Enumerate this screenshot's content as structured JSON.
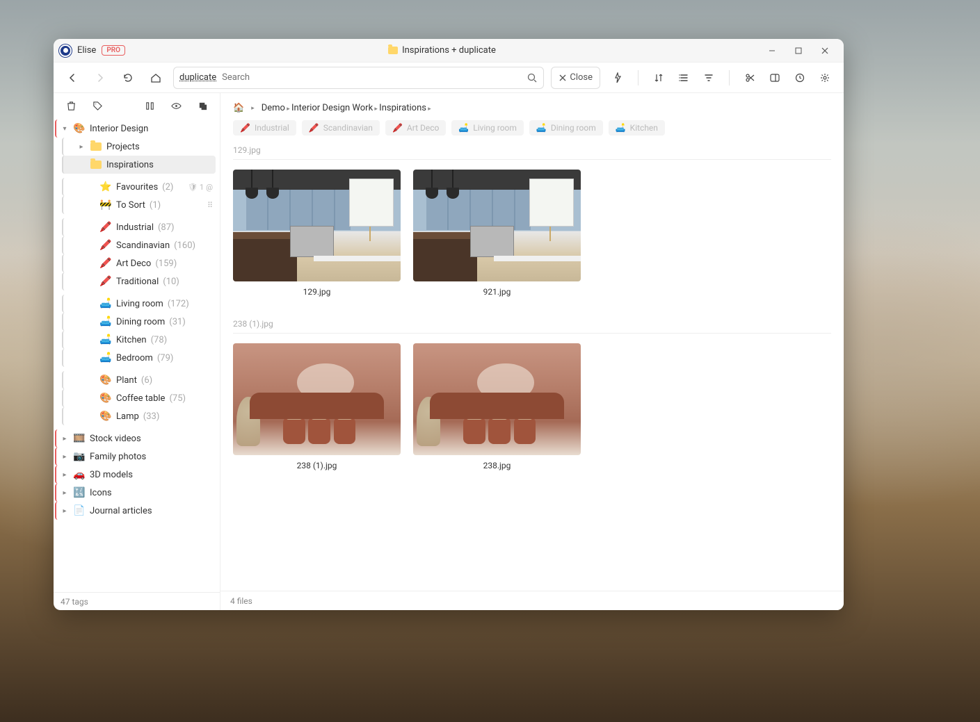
{
  "titlebar": {
    "username": "Elise",
    "pro_label": "PRO",
    "title_prefix_icon": "folder-icon",
    "title": "Inspirations + duplicate"
  },
  "toolbar": {
    "search_term": "duplicate",
    "search_placeholder": "Search",
    "close_label": "Close"
  },
  "sidebar": {
    "footer": "47 tags",
    "root": {
      "label": "Interior Design",
      "icon": "🎨"
    },
    "libraries": [
      {
        "icon": "fld",
        "label": "Projects",
        "chev": true
      },
      {
        "icon": "fld",
        "label": "Inspirations",
        "chev": false,
        "selected": true
      }
    ],
    "favs": [
      {
        "icon": "⭐",
        "label": "Favourites",
        "count": "(2)",
        "tail": [
          "🛡",
          "1",
          "@"
        ]
      },
      {
        "icon": "🚧",
        "label": "To Sort",
        "count": "(1)",
        "tail": [
          "⠿"
        ]
      }
    ],
    "styles": [
      {
        "icon": "🖍️",
        "label": "Industrial",
        "count": "(87)"
      },
      {
        "icon": "🖍️",
        "label": "Scandinavian",
        "count": "(160)"
      },
      {
        "icon": "🖍️",
        "label": "Art Deco",
        "count": "(159)"
      },
      {
        "icon": "🖍️",
        "label": "Traditional",
        "count": "(10)"
      }
    ],
    "rooms": [
      {
        "icon": "🛋️",
        "label": "Living room",
        "count": "(172)"
      },
      {
        "icon": "🛋️",
        "label": "Dining room",
        "count": "(31)"
      },
      {
        "icon": "🛋️",
        "label": "Kitchen",
        "count": "(78)"
      },
      {
        "icon": "🛋️",
        "label": "Bedroom",
        "count": "(79)"
      }
    ],
    "objects": [
      {
        "icon": "🎨",
        "label": "Plant",
        "count": "(6)"
      },
      {
        "icon": "🎨",
        "label": "Coffee table",
        "count": "(75)"
      },
      {
        "icon": "🎨",
        "label": "Lamp",
        "count": "(33)"
      }
    ],
    "other_libs": [
      {
        "icon": "🎞️",
        "label": "Stock videos"
      },
      {
        "icon": "📷",
        "label": "Family photos"
      },
      {
        "icon": "🚗",
        "label": "3D models"
      },
      {
        "icon": "🔣",
        "label": "Icons"
      },
      {
        "icon": "📄",
        "label": "Journal articles"
      }
    ]
  },
  "main": {
    "crumbs": [
      "Demo",
      "Interior Design Work",
      "Inspirations"
    ],
    "filter_tags": [
      {
        "dot": "🖍️",
        "label": "Industrial"
      },
      {
        "dot": "🖍️",
        "label": "Scandinavian"
      },
      {
        "dot": "🖍️",
        "label": "Art Deco"
      },
      {
        "dot": "🛋️",
        "label": "Living room"
      },
      {
        "dot": "🛋️",
        "label": "Dining room"
      },
      {
        "dot": "🛋️",
        "label": "Kitchen"
      }
    ],
    "groups": [
      {
        "header": "129.jpg",
        "items": [
          {
            "name": "129.jpg",
            "kind": "kitchen"
          },
          {
            "name": "921.jpg",
            "kind": "kitchen"
          }
        ]
      },
      {
        "header": "238 (1).jpg",
        "items": [
          {
            "name": "238 (1).jpg",
            "kind": "terra"
          },
          {
            "name": "238.jpg",
            "kind": "terra"
          }
        ]
      }
    ],
    "footer": "4 files"
  }
}
